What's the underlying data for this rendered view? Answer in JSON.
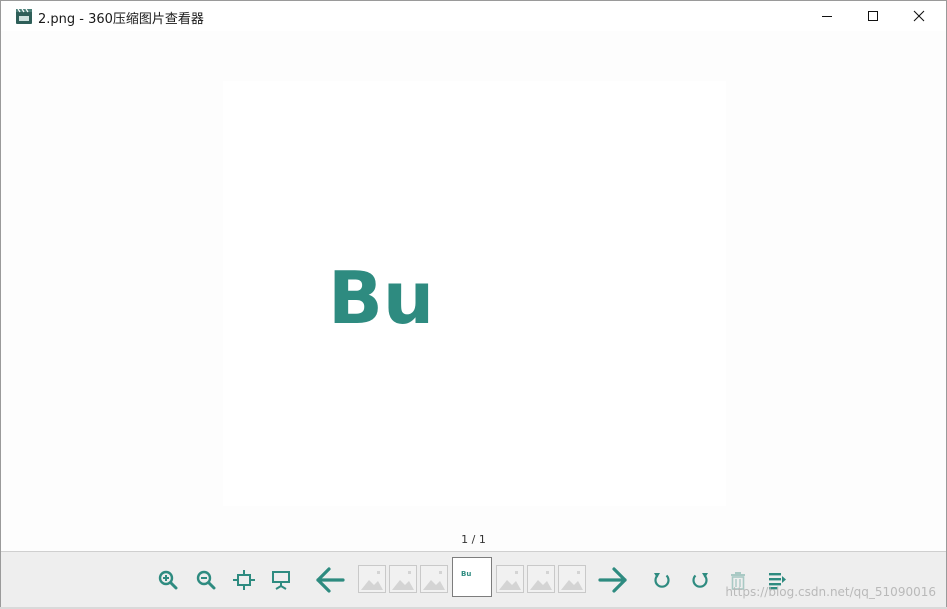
{
  "window": {
    "title": "2.png - 360压缩图片查看器"
  },
  "titlebar_buttons": [
    {
      "name": "minimize-button",
      "icon": "minimize-icon"
    },
    {
      "name": "maximize-button",
      "icon": "maximize-icon"
    },
    {
      "name": "close-button",
      "icon": "close-icon"
    }
  ],
  "viewer": {
    "image_text": "Bu",
    "page_indicator": "1 / 1"
  },
  "toolbar": {
    "buttons": [
      "zoom-in-icon",
      "zoom-out-icon",
      "fit-window-icon",
      "slideshow-icon",
      "previous-arrow-icon",
      "next-arrow-icon",
      "rotate-left-icon",
      "rotate-right-icon",
      "delete-icon",
      "properties-icon"
    ],
    "thumbnails_count": 7,
    "active_thumbnail_caption": "Bu"
  },
  "watermark": "https://blog.csdn.net/qq_51090016",
  "colors": {
    "accent": "#2e8b80",
    "toolbar_bg": "#eeeeee",
    "disabled": "#a9c9c4"
  }
}
